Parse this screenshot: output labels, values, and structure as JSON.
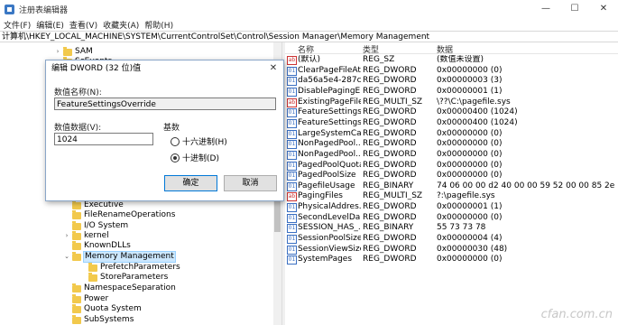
{
  "window": {
    "title": "注册表编辑器",
    "controls": [
      "—",
      "☐",
      "✕"
    ]
  },
  "menu": [
    "文件(F)",
    "编辑(E)",
    "查看(V)",
    "收藏夹(A)",
    "帮助(H)"
  ],
  "address": "计算机\\HKEY_LOCAL_MACHINE\\SYSTEM\\CurrentControlSet\\Control\\Session Manager\\Memory Management",
  "tree": [
    {
      "label": "SAM",
      "arrow": "›"
    },
    {
      "label": "ScEvents",
      "arrow": ""
    },
    {
      "label": "Executive",
      "arrow": ""
    },
    {
      "label": "FileRenameOperations",
      "arrow": ""
    },
    {
      "label": "I/O System",
      "arrow": ""
    },
    {
      "label": "kernel",
      "arrow": "›"
    },
    {
      "label": "KnownDLLs",
      "arrow": ""
    },
    {
      "label": "Memory Management",
      "arrow": "⌄",
      "selected": true
    },
    {
      "label": "PrefetchParameters",
      "arrow": ""
    },
    {
      "label": "StoreParameters",
      "arrow": ""
    },
    {
      "label": "NamespaceSeparation",
      "arrow": ""
    },
    {
      "label": "Power",
      "arrow": ""
    },
    {
      "label": "Quota System",
      "arrow": ""
    },
    {
      "label": "SubSystems",
      "arrow": ""
    }
  ],
  "columns": {
    "name": "名称",
    "type": "类型",
    "data": "数据"
  },
  "values": [
    {
      "icon": "ab",
      "name": "(默认)",
      "type": "REG_SZ",
      "data": "(数值未设置)"
    },
    {
      "icon": "bin",
      "name": "ClearPageFileAt...",
      "type": "REG_DWORD",
      "data": "0x00000000 (0)"
    },
    {
      "icon": "bin",
      "name": "da56a5e4-287c...",
      "type": "REG_DWORD",
      "data": "0x00000003 (3)"
    },
    {
      "icon": "bin",
      "name": "DisablePagingE...",
      "type": "REG_DWORD",
      "data": "0x00000001 (1)"
    },
    {
      "icon": "ab",
      "name": "ExistingPageFiles",
      "type": "REG_MULTI_SZ",
      "data": "\\??\\C:\\pagefile.sys"
    },
    {
      "icon": "bin",
      "name": "FeatureSettings...",
      "type": "REG_DWORD",
      "data": "0x00000400 (1024)"
    },
    {
      "icon": "bin",
      "name": "FeatureSettings...",
      "type": "REG_DWORD",
      "data": "0x00000400 (1024)"
    },
    {
      "icon": "bin",
      "name": "LargeSystemCa...",
      "type": "REG_DWORD",
      "data": "0x00000000 (0)"
    },
    {
      "icon": "bin",
      "name": "NonPagedPool...",
      "type": "REG_DWORD",
      "data": "0x00000000 (0)"
    },
    {
      "icon": "bin",
      "name": "NonPagedPool...",
      "type": "REG_DWORD",
      "data": "0x00000000 (0)"
    },
    {
      "icon": "bin",
      "name": "PagedPoolQuota",
      "type": "REG_DWORD",
      "data": "0x00000000 (0)"
    },
    {
      "icon": "bin",
      "name": "PagedPoolSize",
      "type": "REG_DWORD",
      "data": "0x00000000 (0)"
    },
    {
      "icon": "bin",
      "name": "PagefileUsage",
      "type": "REG_BINARY",
      "data": "74 06 00 00 d2 40 00 00 59 52 00 00 85 2e 00 0..."
    },
    {
      "icon": "ab",
      "name": "PagingFiles",
      "type": "REG_MULTI_SZ",
      "data": "?:\\pagefile.sys"
    },
    {
      "icon": "bin",
      "name": "PhysicalAddres...",
      "type": "REG_DWORD",
      "data": "0x00000001 (1)"
    },
    {
      "icon": "bin",
      "name": "SecondLevelDa...",
      "type": "REG_DWORD",
      "data": "0x00000000 (0)"
    },
    {
      "icon": "bin",
      "name": "SESSION_HAS_...",
      "type": "REG_BINARY",
      "data": "55 73 73 78"
    },
    {
      "icon": "bin",
      "name": "SessionPoolSize",
      "type": "REG_DWORD",
      "data": "0x00000004 (4)"
    },
    {
      "icon": "bin",
      "name": "SessionViewSize",
      "type": "REG_DWORD",
      "data": "0x00000030 (48)"
    },
    {
      "icon": "bin",
      "name": "SystemPages",
      "type": "REG_DWORD",
      "data": "0x00000000 (0)"
    }
  ],
  "dialog": {
    "title": "编辑 DWORD (32 位)值",
    "name_label": "数值名称(N):",
    "name_value": "FeatureSettingsOverride",
    "data_label": "数值数据(V):",
    "data_value": "1024",
    "base_label": "基数",
    "hex_label": "十六进制(H)",
    "dec_label": "十进制(D)",
    "selected_base": "decimal",
    "ok_label": "确定",
    "cancel_label": "取消",
    "close_glyph": "✕"
  },
  "watermark": "cfan.com.cn"
}
